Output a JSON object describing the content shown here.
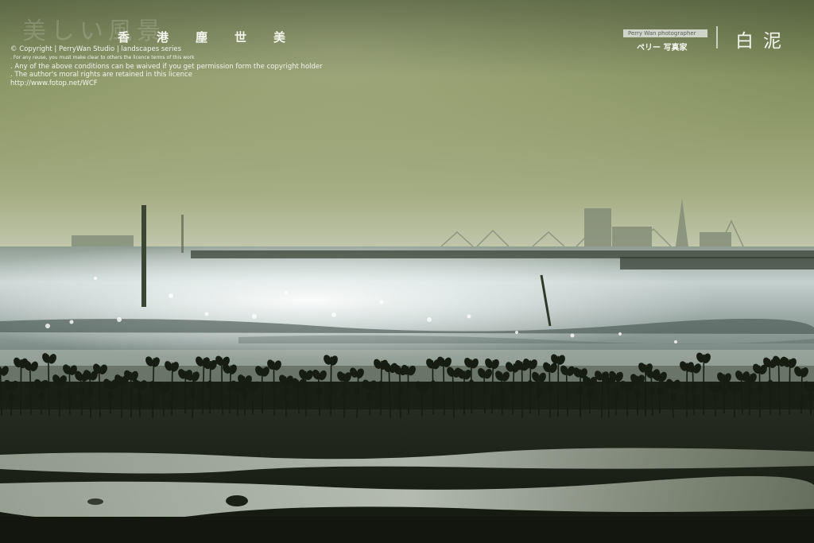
{
  "image": {
    "description_name": "mudflat-sunset-landscape",
    "colors": {
      "sky_top": "#76855a",
      "sky_mid": "#909a6b",
      "sky_horizon": "#c2c8a6",
      "water_light": "#dfeaea",
      "water_dark": "#3f4b45",
      "silhouette": "#151a12",
      "mud": "#1e2317"
    }
  },
  "overlay": {
    "watermark": "美しい風景",
    "series_title": "香港塵世美",
    "copyright": {
      "line1": "© Copyright | PerryWan Studio | landscapes series",
      "line2": ". For any reuse, you must make clear to others the licence terms of this work",
      "line3": ". Any of the above conditions can be waived if you get permission form the copyright holder",
      "line4": ". The author's moral rights are retained in this licence",
      "line5": "http://www.fotop.net/WCF"
    },
    "photographer_badge": "Perry Wan photographer",
    "photographer_name": "ペリー 写真家",
    "location": "白泥"
  }
}
